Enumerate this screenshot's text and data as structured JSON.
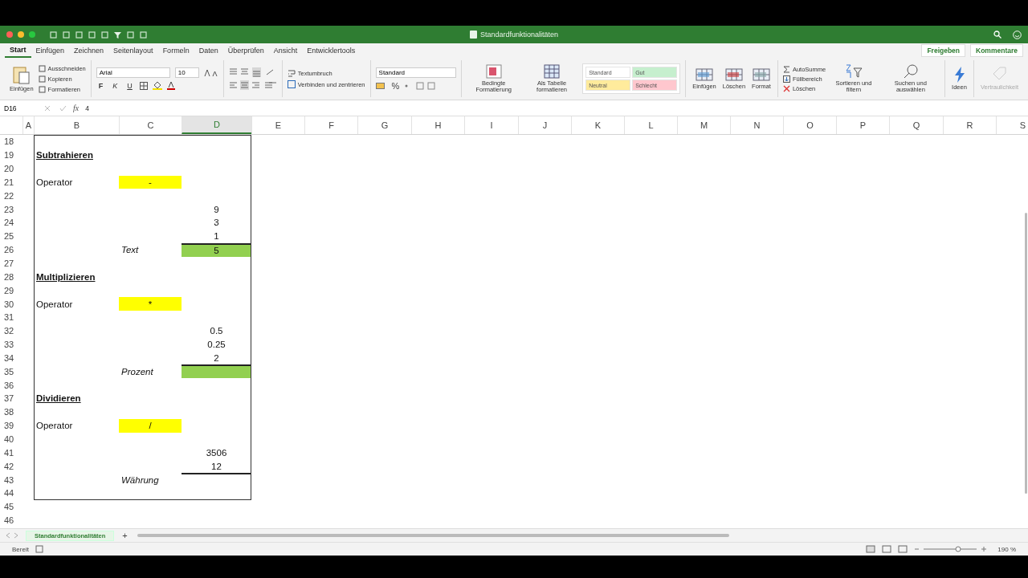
{
  "window": {
    "title": "Standardfunktionalitäten"
  },
  "tabs": [
    {
      "label": "Start",
      "selected": true
    },
    {
      "label": "Einfügen",
      "selected": false
    },
    {
      "label": "Zeichnen",
      "selected": false
    },
    {
      "label": "Seitenlayout",
      "selected": false
    },
    {
      "label": "Formeln",
      "selected": false
    },
    {
      "label": "Daten",
      "selected": false
    },
    {
      "label": "Überprüfen",
      "selected": false
    },
    {
      "label": "Ansicht",
      "selected": false
    },
    {
      "label": "Entwicklertools",
      "selected": false
    }
  ],
  "share_buttons": [
    "Freigeben",
    "Kommentare"
  ],
  "ribbon": {
    "paste": "Einfügen",
    "clipboard": [
      "Ausschneiden",
      "Kopieren",
      "Formatieren"
    ],
    "font": "Arial",
    "font_size": "10",
    "bold": "F",
    "italic": "K",
    "underline": "U",
    "wrap": "Textumbruch",
    "merge": "Verbinden und zentrieren",
    "number_format": "Standard",
    "percent": "%",
    "conditional": "Bedingte Formatierung",
    "as_table": "Als Tabelle formatieren",
    "cell_styles": [
      {
        "label": "Standard",
        "color": "#ffffff"
      },
      {
        "label": "Gut",
        "color": "#c6efce"
      },
      {
        "label": "Neutral",
        "color": "#ffeb9c"
      },
      {
        "label": "Schlecht",
        "color": "#ffc7ce"
      }
    ],
    "cells": [
      "Einfügen",
      "Löschen",
      "Format"
    ],
    "editing": [
      "AutoSumme",
      "Füllbereich",
      "Löschen"
    ],
    "sort": "Sortieren und filtern",
    "find": "Suchen und auswählen",
    "ideas": "Ideen",
    "sensitivity": {
      "label": "Vertraulichkeit",
      "disabled": true
    }
  },
  "formula_bar": {
    "name_box": "D16",
    "fx": "fx",
    "value": "4"
  },
  "columns": [
    {
      "label": "A",
      "selected": false
    },
    {
      "label": "B",
      "selected": false
    },
    {
      "label": "C",
      "selected": false
    },
    {
      "label": "D",
      "selected": true
    },
    {
      "label": "E",
      "selected": false
    },
    {
      "label": "F",
      "selected": false
    },
    {
      "label": "G",
      "selected": false
    },
    {
      "label": "H",
      "selected": false
    },
    {
      "label": "I",
      "selected": false
    },
    {
      "label": "J",
      "selected": false
    },
    {
      "label": "K",
      "selected": false
    },
    {
      "label": "L",
      "selected": false
    },
    {
      "label": "M",
      "selected": false
    },
    {
      "label": "N",
      "selected": false
    },
    {
      "label": "O",
      "selected": false
    },
    {
      "label": "P",
      "selected": false
    },
    {
      "label": "Q",
      "selected": false
    },
    {
      "label": "R",
      "selected": false
    },
    {
      "label": "S",
      "selected": false
    }
  ],
  "rows": [
    {
      "number": "18"
    },
    {
      "number": "19",
      "b": {
        "text": "Subtrahieren",
        "kind": "heading"
      }
    },
    {
      "number": "20"
    },
    {
      "number": "21",
      "b": {
        "text": "Operator",
        "kind": "text"
      },
      "c": {
        "text": "-",
        "kind": "center",
        "color": "#ffff00"
      }
    },
    {
      "number": "22"
    },
    {
      "number": "23",
      "d": {
        "text": "9",
        "kind": "center"
      }
    },
    {
      "number": "24",
      "d": {
        "text": "3",
        "kind": "center"
      }
    },
    {
      "number": "25",
      "d": {
        "text": "1",
        "kind": "center"
      }
    },
    {
      "number": "26",
      "c": {
        "text": "Text",
        "kind": "italic"
      },
      "d": {
        "text": "5",
        "kind": "center",
        "color": "#92d050",
        "rule_above": true
      }
    },
    {
      "number": "27"
    },
    {
      "number": "28",
      "b": {
        "text": "Multiplizieren",
        "kind": "heading"
      }
    },
    {
      "number": "29"
    },
    {
      "number": "30",
      "b": {
        "text": "Operator",
        "kind": "text"
      },
      "c": {
        "text": "*",
        "kind": "center",
        "color": "#ffff00"
      }
    },
    {
      "number": "31"
    },
    {
      "number": "32",
      "d": {
        "text": "0.5",
        "kind": "center"
      }
    },
    {
      "number": "33",
      "d": {
        "text": "0.25",
        "kind": "center"
      }
    },
    {
      "number": "34",
      "d": {
        "text": "2",
        "kind": "center"
      }
    },
    {
      "number": "35",
      "c": {
        "text": "Prozent",
        "kind": "italic"
      },
      "d": {
        "kind": "center",
        "color": "#92d050",
        "rule_above": true
      }
    },
    {
      "number": "36"
    },
    {
      "number": "37",
      "b": {
        "text": "Dividieren",
        "kind": "heading"
      }
    },
    {
      "number": "38"
    },
    {
      "number": "39",
      "b": {
        "text": "Operator",
        "kind": "text"
      },
      "c": {
        "text": "/",
        "kind": "center",
        "color": "#ffff00"
      }
    },
    {
      "number": "40"
    },
    {
      "number": "41",
      "d": {
        "text": "3506",
        "kind": "center"
      }
    },
    {
      "number": "42",
      "d": {
        "text": "12",
        "kind": "center"
      }
    },
    {
      "number": "43",
      "c": {
        "text": "Währung",
        "kind": "italic"
      },
      "d": {
        "kind": "center",
        "rule_above": true
      }
    },
    {
      "number": "44"
    },
    {
      "number": "45"
    },
    {
      "number": "46"
    }
  ],
  "sheet_tabs": [
    {
      "label": "Standardfunktionalitäten",
      "selected": true
    }
  ],
  "add_sheet": "+",
  "status_bar": {
    "status": "Bereit",
    "zoom": "190 %"
  }
}
